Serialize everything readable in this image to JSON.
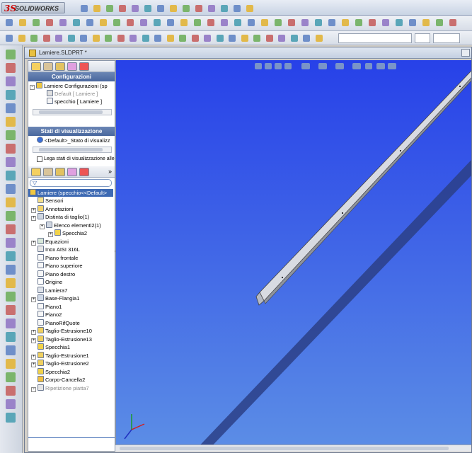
{
  "app": {
    "brand": "SOLIDWORKS"
  },
  "document": {
    "title": "Lamiere.SLDPRT *"
  },
  "configurations": {
    "header": "Configurazioni",
    "root": "Lamiere Configurazioni  (sp",
    "items": [
      "Default [ Lamiere ]",
      "specchio [ Lamiere ]"
    ]
  },
  "display_states": {
    "header": "Stati di visualizzazione",
    "items": [
      "<Default>_Stato di visualizz"
    ],
    "link_checkbox_label": "Lega stati di visualizzazione alle con"
  },
  "feature_tree": {
    "root": "Lamiere  (specchio<<Default>",
    "items": [
      {
        "label": "Sensori",
        "icon": "sensor-icon",
        "expand": false,
        "indent": 0
      },
      {
        "label": "Annotazioni",
        "icon": "annotation-icon",
        "expand": true,
        "indent": 0
      },
      {
        "label": "Distinta di taglio(1)",
        "icon": "cutlist-icon",
        "expand": true,
        "indent": 0
      },
      {
        "label": "Elenco elementi2(1)",
        "icon": "cutlist-item-icon",
        "expand": true,
        "indent": 1
      },
      {
        "label": "Specchia2",
        "icon": "mirror-icon",
        "expand": true,
        "indent": 2
      },
      {
        "label": "Equazioni",
        "icon": "equation-icon",
        "expand": true,
        "indent": 0
      },
      {
        "label": "Inox AISI 316L",
        "icon": "material-icon",
        "expand": false,
        "indent": 0
      },
      {
        "label": "Piano frontale",
        "icon": "plane-icon",
        "expand": false,
        "indent": 0
      },
      {
        "label": "Piano superiore",
        "icon": "plane-icon",
        "expand": false,
        "indent": 0
      },
      {
        "label": "Piano destro",
        "icon": "plane-icon",
        "expand": false,
        "indent": 0
      },
      {
        "label": "Origine",
        "icon": "origin-icon",
        "expand": false,
        "indent": 0
      },
      {
        "label": "Lamiera7",
        "icon": "sheetmetal-icon",
        "expand": false,
        "indent": 0
      },
      {
        "label": "Base-Flangia1",
        "icon": "base-flange-icon",
        "expand": true,
        "indent": 0
      },
      {
        "label": "Piano1",
        "icon": "plane-icon",
        "expand": false,
        "indent": 0
      },
      {
        "label": "Piano2",
        "icon": "plane-icon",
        "expand": false,
        "indent": 0
      },
      {
        "label": "PianoRifQuote",
        "icon": "plane-icon",
        "expand": false,
        "indent": 0
      },
      {
        "label": "Taglio-Estrusione10",
        "icon": "cut-extrude-icon",
        "expand": true,
        "indent": 0
      },
      {
        "label": "Taglio-Estrusione13",
        "icon": "cut-extrude-icon",
        "expand": true,
        "indent": 0
      },
      {
        "label": "Specchia1",
        "icon": "mirror-icon",
        "expand": false,
        "indent": 0
      },
      {
        "label": "Taglio-Estrusione1",
        "icon": "cut-extrude-icon",
        "expand": true,
        "indent": 0
      },
      {
        "label": "Taglio-Estrusione2",
        "icon": "cut-extrude-icon",
        "expand": true,
        "indent": 0
      },
      {
        "label": "Specchia2",
        "icon": "mirror-icon",
        "expand": false,
        "indent": 0
      },
      {
        "label": "Corpo-Cancella2",
        "icon": "delete-body-icon",
        "expand": false,
        "indent": 0
      },
      {
        "label": "Ripetizione piatta7",
        "icon": "flat-pattern-icon",
        "expand": true,
        "indent": 0,
        "suppressed": true
      }
    ]
  },
  "colors": {
    "viewport_top": "#2741e8",
    "viewport_bottom": "#5c8ee6",
    "accent": "#3e6ab3"
  }
}
